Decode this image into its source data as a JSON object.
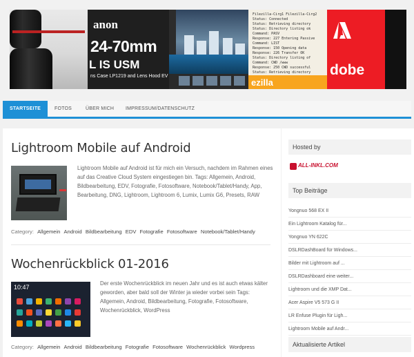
{
  "banner": {
    "canon_text": "anon",
    "zoom_text": "24-70mm",
    "usm_text": "L IS USM",
    "case_text": "ns Case LP1219 and Lens Hood EV",
    "zilla_text": "ezilla",
    "adobe_text": "dobe",
    "code_text": "Filezilla-Cirg1 Filezilla-Cirg2\nStatus: Connected\nStatus: Retrieving directory\nStatus: Directory listing ok\nCommand: PASV\nResponse: 227 Entering Passive\nCommand: LIST\nResponse: 150 Opening data\nResponse: 226 Transfer OK\nStatus: Directory listing of\nCommand: CWD /www\nResponse: 250 CWD successful\nStatus: Retrieving directory"
  },
  "nav": {
    "items": [
      {
        "label": "Startseite",
        "active": true
      },
      {
        "label": "Fotos",
        "active": false
      },
      {
        "label": "Über mich",
        "active": false
      },
      {
        "label": "Impressum/Datenschutz",
        "active": false
      }
    ]
  },
  "posts": [
    {
      "title": "Lightroom Mobile auf Android",
      "excerpt": "Lightroom Mobile auf Android ist für mich ein Versuch, nachdem im Rahmen eines auf das Creative Cloud System eingestiegen bin. Tags: Allgemein, Android, Bildbearbeitung, EDV, Fotografie, Fotosoftware, Notebook/Tablet/Handy, App, Bearbeitung, DNG, Lightroom, Lightroom 6, Lumix, Lumix G6, Presets, RAW",
      "category_label": "Category:",
      "categories": [
        "Allgemein",
        "Android",
        "Bildbearbeitung",
        "EDV",
        "Fotografie",
        "Fotosoftware",
        "Notebook/Tablet/Handy"
      ]
    },
    {
      "title": "Wochenrückblick 01-2016",
      "excerpt": "Der erste Wochenrückblick im neuen Jahr und es ist auch etwas kälter geworden, aber bald soll der Winter ja wieder vorbei sein Tags: Allgemein, Android, Bildbearbeitung, Fotografie, Fotosoftware, Wochenrückblick, WordPress",
      "thumb_clock": "10:47",
      "category_label": "Category:",
      "categories": [
        "Allgemein",
        "Android",
        "Bildbearbeitung",
        "Fotografie",
        "Fotosoftware",
        "Wochenrückblick",
        "Wordpress"
      ]
    }
  ],
  "sidebar": {
    "hosted_title": "Hosted by",
    "hoster_name": "ALL-INKL.COM",
    "top_title": "Top Beiträge",
    "top_items": [
      "Yongnuo 568 EX II",
      "Ein Lightroom Katalog für...",
      "Yongnuo YN 622C",
      "DSLRDashBoard für Windows...",
      "Bilder mit Lightroom auf ...",
      "DSLRDashboard eine weiter...",
      "Lightroom und die XMP Dat...",
      "Acer Aspire V5 573 G II",
      "LR Enfuse Plugin für Ligh...",
      "Lightroom Mobile auf Andr..."
    ],
    "updated_title": "Aktualisierte Artikel"
  },
  "colors": {
    "accent": "#1e90d6",
    "adobe_red": "#ed1c24",
    "allinkl_red": "#c8102e"
  }
}
